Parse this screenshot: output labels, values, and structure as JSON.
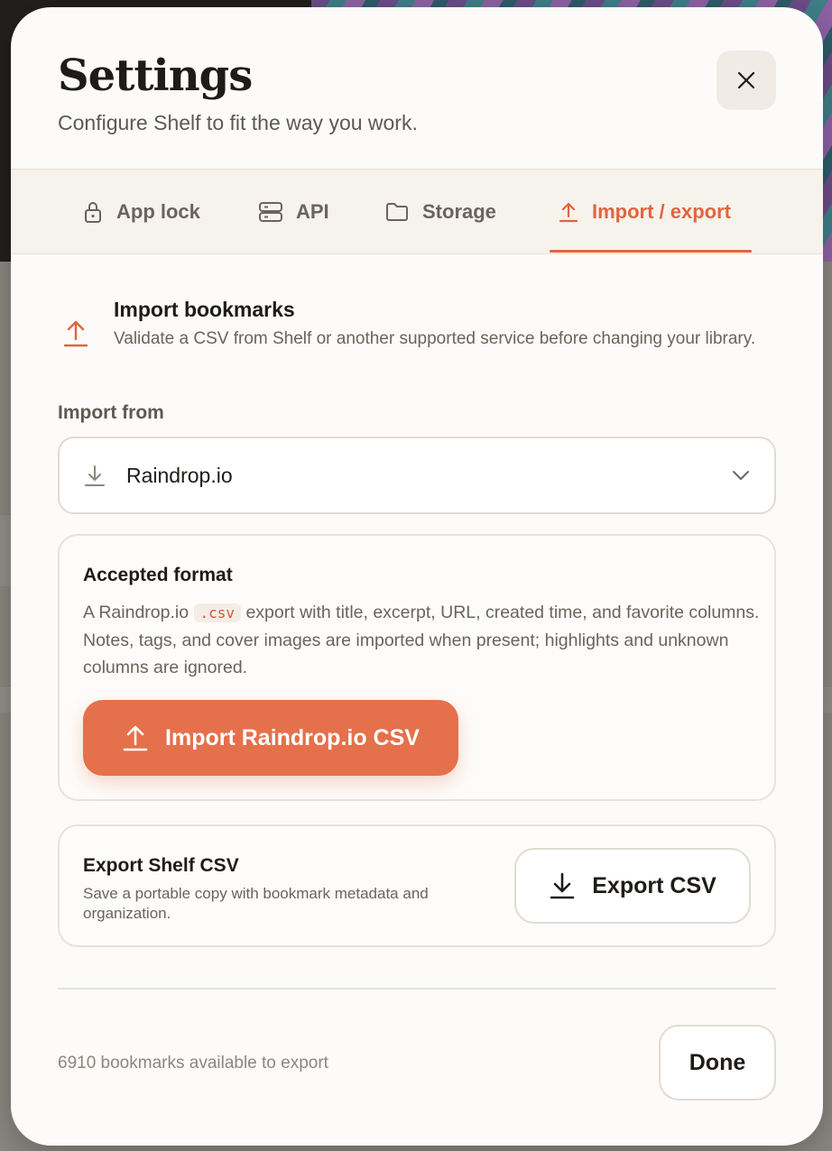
{
  "modal": {
    "title": "Settings",
    "subtitle": "Configure Shelf to fit the way you work.",
    "close_icon": "close-icon"
  },
  "tabs": [
    {
      "label": "App lock",
      "icon": "lock-icon",
      "active": false
    },
    {
      "label": "API",
      "icon": "server-icon",
      "active": false
    },
    {
      "label": "Storage",
      "icon": "folder-icon",
      "active": false
    },
    {
      "label": "Import / export",
      "icon": "upload-icon",
      "active": true
    }
  ],
  "import_section": {
    "title": "Import bookmarks",
    "description": "Validate a CSV from Shelf or another supported service before changing your library."
  },
  "import_from": {
    "label": "Import from",
    "selected": "Raindrop.io"
  },
  "format_card": {
    "title": "Accepted format",
    "text_before": "A Raindrop.io ",
    "code": ".csv",
    "text_after": " export with title, excerpt, URL, created time, and favorite columns. Notes, tags, and cover images are imported when present; highlights and unknown columns are ignored.",
    "button_label": "Import Raindrop.io CSV"
  },
  "export_card": {
    "title": "Export Shelf CSV",
    "description": "Save a portable copy with bookmark metadata and organization.",
    "button_label": "Export CSV"
  },
  "footer": {
    "status": "6910 bookmarks available to export",
    "done_label": "Done"
  },
  "colors": {
    "accent": "#e5704c",
    "accent_text": "#e0653f",
    "background": "#fcfbf9"
  }
}
